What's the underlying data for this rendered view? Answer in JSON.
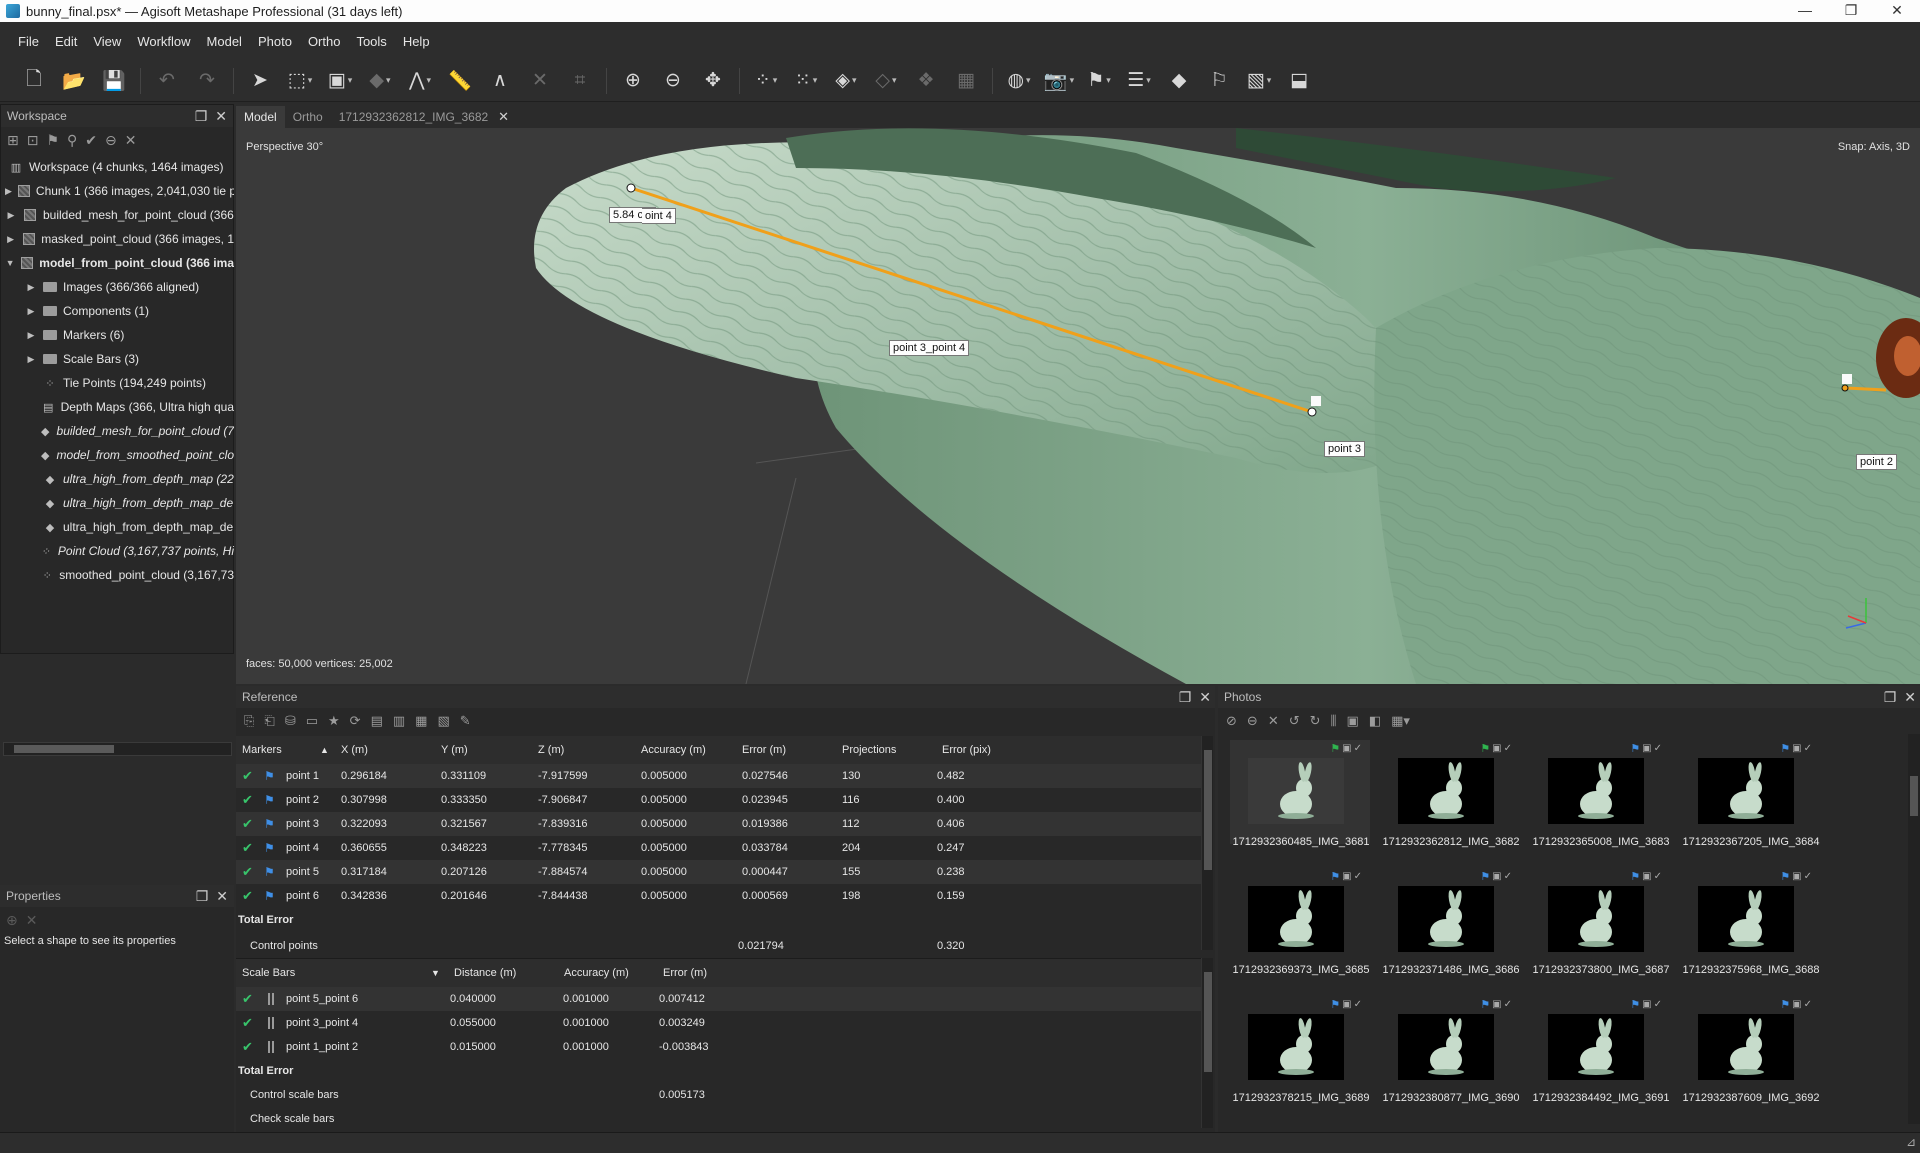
{
  "window": {
    "title": "bunny_final.psx* — Agisoft Metashape Professional (31 days left)",
    "minimize": "—",
    "maximize": "❐",
    "close": "✕"
  },
  "menu": [
    "File",
    "Edit",
    "View",
    "Workflow",
    "Model",
    "Photo",
    "Ortho",
    "Tools",
    "Help"
  ],
  "workspace": {
    "title": "Workspace",
    "items": [
      {
        "label": "Workspace (4 chunks, 1464 images)",
        "level": 0,
        "arrow": "",
        "icon": "workspace",
        "style": ""
      },
      {
        "label": "Chunk 1 (366 images, 2,041,030 tie p",
        "level": 0,
        "arrow": "▶",
        "icon": "chunk",
        "style": ""
      },
      {
        "label": "builded_mesh_for_point_cloud (366",
        "level": 0,
        "arrow": "▶",
        "icon": "chunk",
        "style": ""
      },
      {
        "label": "masked_point_cloud (366 images, 1",
        "level": 0,
        "arrow": "▶",
        "icon": "chunk",
        "style": ""
      },
      {
        "label": "model_from_point_cloud (366 ima",
        "level": 0,
        "arrow": "▼",
        "icon": "chunk",
        "style": "bold"
      },
      {
        "label": "Images (366/366 aligned)",
        "level": 1,
        "arrow": "▶",
        "icon": "folder",
        "style": ""
      },
      {
        "label": "Components (1)",
        "level": 1,
        "arrow": "▶",
        "icon": "folder",
        "style": ""
      },
      {
        "label": "Markers (6)",
        "level": 1,
        "arrow": "▶",
        "icon": "folder",
        "style": ""
      },
      {
        "label": "Scale Bars (3)",
        "level": 1,
        "arrow": "▶",
        "icon": "folder",
        "style": ""
      },
      {
        "label": "Tie Points (194,249 points)",
        "level": 1,
        "arrow": "",
        "icon": "points",
        "style": ""
      },
      {
        "label": "Depth Maps (366, Ultra high qua",
        "level": 1,
        "arrow": "",
        "icon": "depth",
        "style": ""
      },
      {
        "label": "builded_mesh_for_point_cloud (7",
        "level": 1,
        "arrow": "",
        "icon": "mesh",
        "style": "ital"
      },
      {
        "label": "model_from_smoothed_point_clo",
        "level": 1,
        "arrow": "",
        "icon": "mesh",
        "style": "ital"
      },
      {
        "label": "ultra_high_from_depth_map (22",
        "level": 1,
        "arrow": "",
        "icon": "mesh",
        "style": "ital"
      },
      {
        "label": "ultra_high_from_depth_map_de",
        "level": 1,
        "arrow": "",
        "icon": "mesh",
        "style": "ital"
      },
      {
        "label": "ultra_high_from_depth_map_de",
        "level": 1,
        "arrow": "",
        "icon": "mesh",
        "style": ""
      },
      {
        "label": "Point Cloud (3,167,737 points, Hi",
        "level": 1,
        "arrow": "",
        "icon": "points",
        "style": "ital"
      },
      {
        "label": "smoothed_point_cloud (3,167,73",
        "level": 1,
        "arrow": "",
        "icon": "points",
        "style": ""
      }
    ]
  },
  "properties": {
    "title": "Properties",
    "hint": "Select a shape to see its properties"
  },
  "tabs": [
    {
      "label": "Model",
      "active": true
    },
    {
      "label": "Ortho",
      "active": false
    },
    {
      "label": "1712932362812_IMG_3682",
      "active": false
    }
  ],
  "viewport": {
    "projection": "Perspective 30°",
    "snap": "Snap: Axis, 3D",
    "stats": "faces: 50,000 vertices: 25,002",
    "labels": {
      "distance": "5.84 cm",
      "point4": "oint 4",
      "bar": "point 3_point 4",
      "point3": "point 3",
      "point2": "point 2"
    }
  },
  "reference": {
    "title": "Reference",
    "marker_headers": [
      "Markers",
      "X (m)",
      "Y (m)",
      "Z (m)",
      "Accuracy (m)",
      "Error (m)",
      "Projections",
      "Error (pix)"
    ],
    "markers": [
      {
        "name": "point 1",
        "x": "0.296184",
        "y": "0.331109",
        "z": "-7.917599",
        "acc": "0.005000",
        "err": "0.027546",
        "proj": "130",
        "pix": "0.482"
      },
      {
        "name": "point 2",
        "x": "0.307998",
        "y": "0.333350",
        "z": "-7.906847",
        "acc": "0.005000",
        "err": "0.023945",
        "proj": "116",
        "pix": "0.400"
      },
      {
        "name": "point 3",
        "x": "0.322093",
        "y": "0.321567",
        "z": "-7.839316",
        "acc": "0.005000",
        "err": "0.019386",
        "proj": "112",
        "pix": "0.406"
      },
      {
        "name": "point 4",
        "x": "0.360655",
        "y": "0.348223",
        "z": "-7.778345",
        "acc": "0.005000",
        "err": "0.033784",
        "proj": "204",
        "pix": "0.247"
      },
      {
        "name": "point 5",
        "x": "0.317184",
        "y": "0.207126",
        "z": "-7.884574",
        "acc": "0.005000",
        "err": "0.000447",
        "proj": "155",
        "pix": "0.238"
      },
      {
        "name": "point 6",
        "x": "0.342836",
        "y": "0.201646",
        "z": "-7.844438",
        "acc": "0.005000",
        "err": "0.000569",
        "proj": "198",
        "pix": "0.159"
      }
    ],
    "marker_total_label": "Total Error",
    "marker_control": {
      "label": "Control points",
      "err": "0.021794",
      "pix": "0.320"
    },
    "scale_headers": [
      "Scale Bars",
      "Distance (m)",
      "Accuracy (m)",
      "Error (m)"
    ],
    "scalebars": [
      {
        "name": "point 5_point 6",
        "dist": "0.040000",
        "acc": "0.001000",
        "err": "0.007412"
      },
      {
        "name": "point 3_point 4",
        "dist": "0.055000",
        "acc": "0.001000",
        "err": "0.003249"
      },
      {
        "name": "point 1_point 2",
        "dist": "0.015000",
        "acc": "0.001000",
        "err": "-0.003843"
      }
    ],
    "scale_total_label": "Total Error",
    "scale_control": {
      "label": "Control scale bars",
      "err": "0.005173"
    },
    "scale_check": {
      "label": "Check scale bars"
    }
  },
  "photos": {
    "title": "Photos",
    "items": [
      {
        "name": "1712932360485_IMG_3681",
        "flag": "green",
        "selected": true
      },
      {
        "name": "1712932362812_IMG_3682",
        "flag": "green",
        "selected": false
      },
      {
        "name": "1712932365008_IMG_3683",
        "flag": "blue",
        "selected": false
      },
      {
        "name": "1712932367205_IMG_3684",
        "flag": "blue",
        "selected": false
      },
      {
        "name": "1712932369373_IMG_3685",
        "flag": "blue",
        "selected": false
      },
      {
        "name": "1712932371486_IMG_3686",
        "flag": "blue",
        "selected": false
      },
      {
        "name": "1712932373800_IMG_3687",
        "flag": "blue",
        "selected": false
      },
      {
        "name": "1712932375968_IMG_3688",
        "flag": "blue",
        "selected": false
      },
      {
        "name": "1712932378215_IMG_3689",
        "flag": "blue",
        "selected": false
      },
      {
        "name": "1712932380877_IMG_3690",
        "flag": "blue",
        "selected": false
      },
      {
        "name": "1712932384492_IMG_3691",
        "flag": "blue",
        "selected": false
      },
      {
        "name": "1712932387609_IMG_3692",
        "flag": "blue",
        "selected": false
      }
    ]
  },
  "colors": {
    "accent_check": "#38c46b",
    "flag_blue": "#3f8fe6",
    "flag_green": "#2fb44f",
    "scale_line": "#f0a01a",
    "surface": "#7fa68a"
  }
}
